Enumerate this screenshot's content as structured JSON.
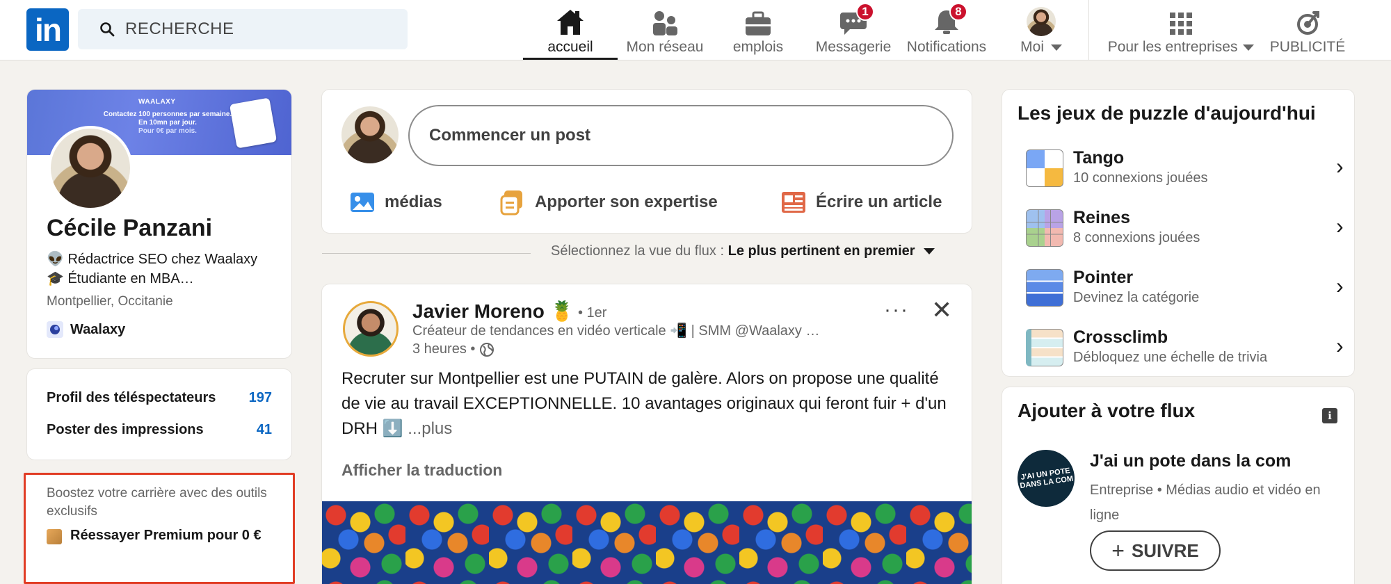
{
  "nav": {
    "logo_text": "in",
    "search_placeholder": "RECHERCHE",
    "items": [
      {
        "label": "accueil",
        "icon": "home-icon",
        "active": true
      },
      {
        "label": "Mon réseau",
        "icon": "network-icon"
      },
      {
        "label": "emplois",
        "icon": "briefcase-icon"
      },
      {
        "label": "Messagerie",
        "icon": "messaging-icon",
        "badge": "1"
      },
      {
        "label": "Notifications",
        "icon": "bell-icon",
        "badge": "8"
      },
      {
        "label": "Moi",
        "icon": "avatar"
      },
      {
        "label": "Pour les entreprises",
        "icon": "grid-icon"
      },
      {
        "label": "PUBLICITÉ",
        "icon": "advertise-icon"
      }
    ]
  },
  "profile": {
    "banner_brand": "WAALAXY",
    "banner_lines": [
      "Contactez 100 personnes par semaine.",
      "En 10mn par jour.",
      "Pour 0€ par mois."
    ],
    "name": "Cécile Panzani",
    "headline": "👽 Rédactrice SEO chez Waalaxy 🎓 Étudiante en MBA…",
    "location": "Montpellier, Occitanie",
    "company": "Waalaxy"
  },
  "stats": [
    {
      "label": "Profil des téléspectateurs",
      "value": "197"
    },
    {
      "label": "Poster des impressions",
      "value": "41"
    }
  ],
  "premium": {
    "text": "Boostez votre carrière avec des outils exclusifs",
    "cta": "Réessayer Premium pour 0 €"
  },
  "composer": {
    "placeholder": "Commencer un post",
    "actions": [
      {
        "label": "médias",
        "icon": "image-icon",
        "color": "#378fe9"
      },
      {
        "label": "Apporter son expertise",
        "icon": "expertise-icon",
        "color": "#e7a33e"
      },
      {
        "label": "Écrire un article",
        "icon": "article-icon",
        "color": "#e06847"
      }
    ]
  },
  "feed_sort": {
    "prefix": "Sélectionnez la vue du flux : ",
    "value": "Le plus pertinent en premier"
  },
  "post": {
    "author": "Javier Moreno 🍍",
    "degree": "• 1er",
    "subtitle": "Créateur de tendances en vidéo verticale 📲 | SMM @Waalaxy …",
    "time": "3 heures •",
    "body": "Recruter sur Montpellier est une PUTAIN de galère. Alors on propose une qualité de vie au travail EXCEPTIONNELLE. 10 avantages originaux qui feront fuir + d'un DRH ⬇️ ",
    "more": "...plus",
    "translate": "Afficher la traduction",
    "menu": "···",
    "close": "✕"
  },
  "games": {
    "title": "Les jeux de puzzle d'aujourd'hui",
    "items": [
      {
        "name": "Tango",
        "sub": "10 connexions jouées"
      },
      {
        "name": "Reines",
        "sub": "8 connexions jouées"
      },
      {
        "name": "Pointer",
        "sub": "Devinez la catégorie"
      },
      {
        "name": "Crossclimb",
        "sub": "Débloquez une échelle de trivia"
      }
    ]
  },
  "add_feed": {
    "title": "Ajouter à votre flux",
    "page_logo": "J'AI UN POTE DANS LA COM",
    "name": "J'ai un pote dans la com",
    "sub": "Entreprise • Médias audio et vidéo en ligne",
    "follow": "SUIVRE",
    "follow_icon": "+"
  }
}
